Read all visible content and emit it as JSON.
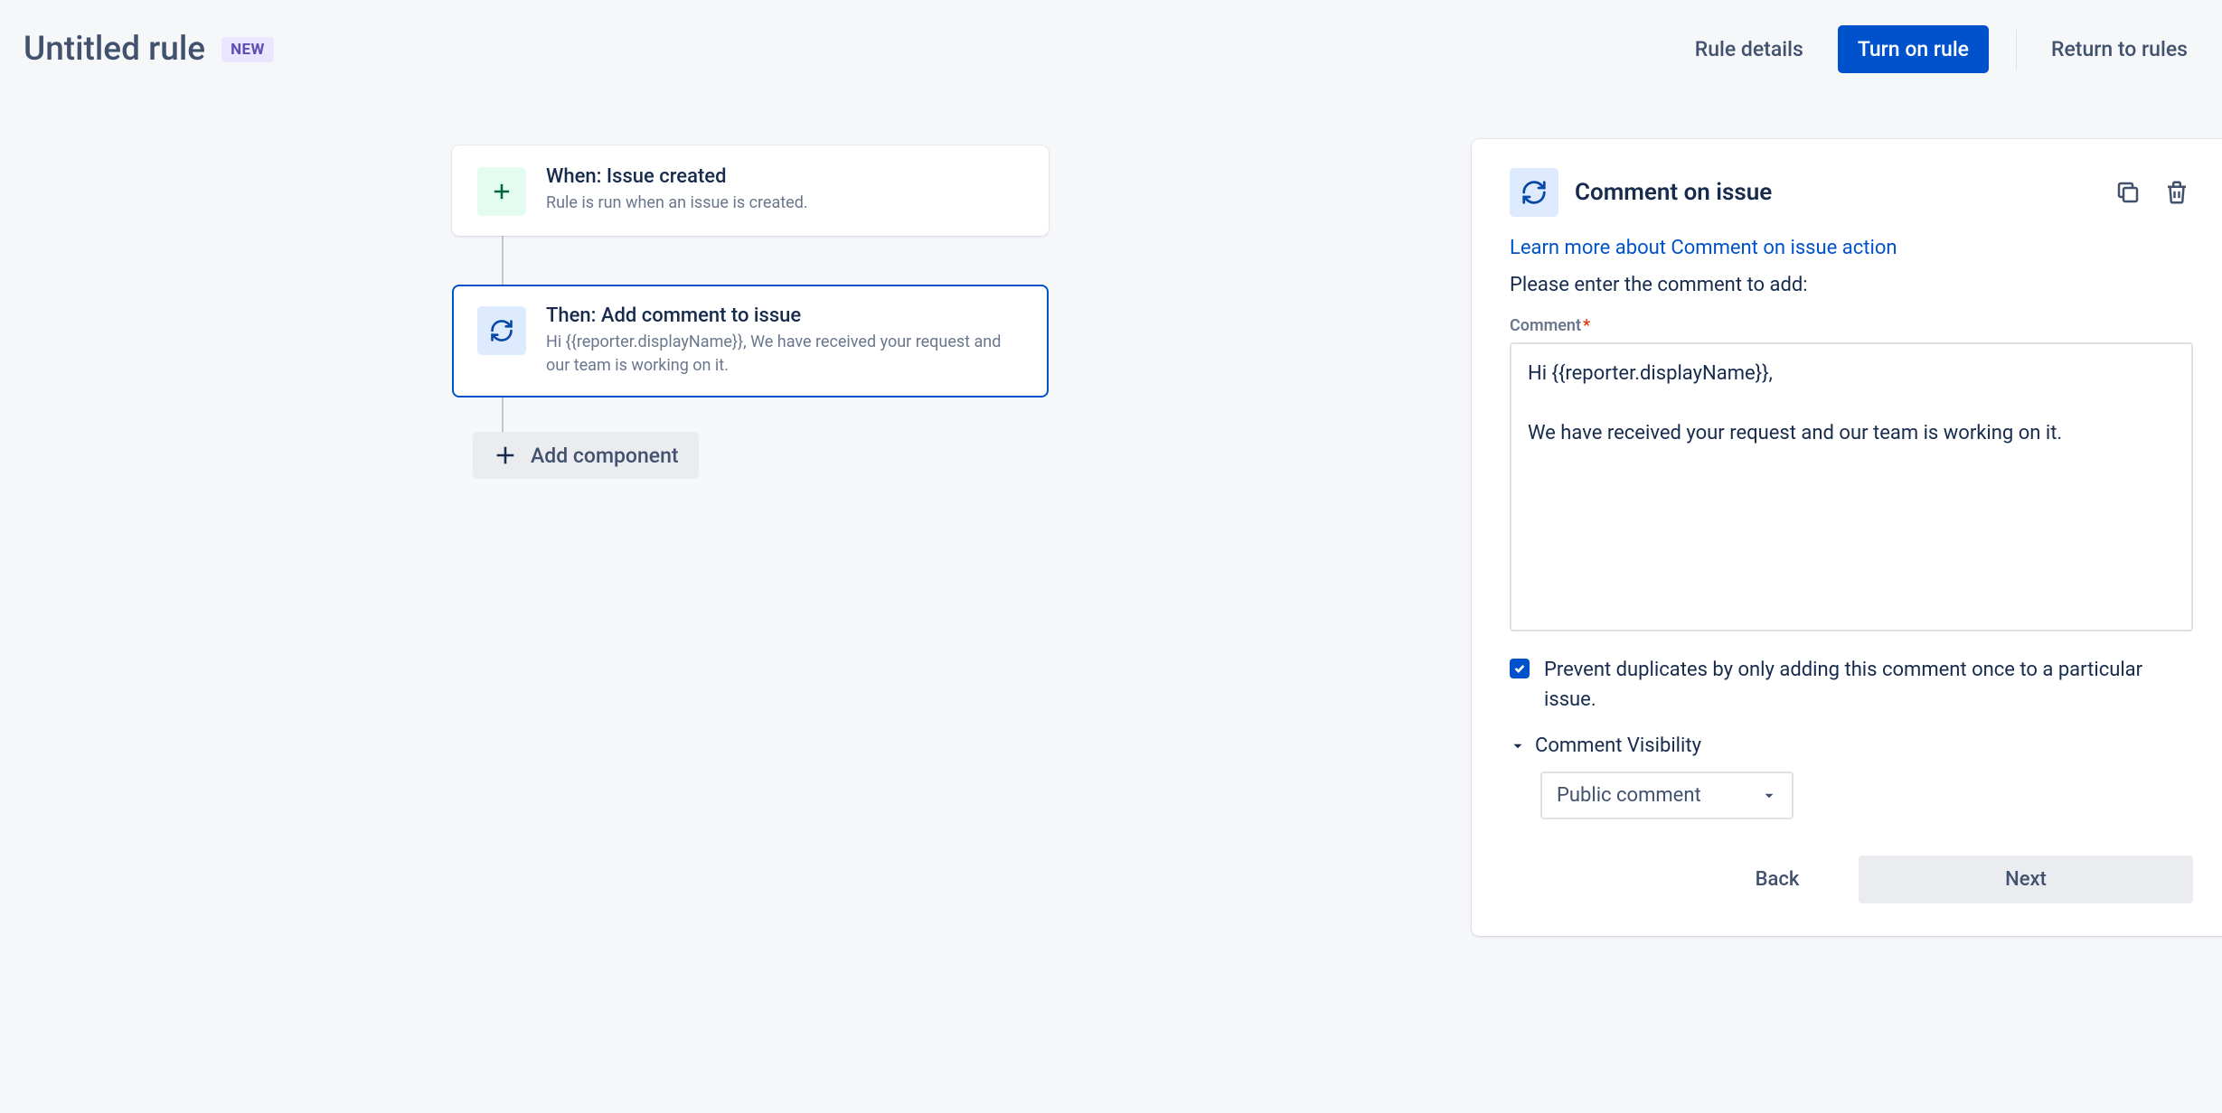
{
  "header": {
    "title": "Untitled rule",
    "badge": "NEW",
    "rule_details": "Rule details",
    "turn_on": "Turn on rule",
    "return": "Return to rules"
  },
  "flow": {
    "trigger": {
      "title": "When: Issue created",
      "subtitle": "Rule is run when an issue is created."
    },
    "action": {
      "title": "Then: Add comment to issue",
      "subtitle": "Hi {{reporter.displayName}}, We have received your request and our team is working on it."
    },
    "add_component": "Add component"
  },
  "panel": {
    "title": "Comment on issue",
    "learn_more": "Learn more about Comment on issue action",
    "instruction": "Please enter the comment to add:",
    "comment_label": "Comment",
    "comment_value": "Hi {{reporter.displayName}},\n\nWe have received your request and our team is working on it.",
    "prevent_dupes": "Prevent duplicates by only adding this comment once to a particular issue.",
    "visibility_label": "Comment Visibility",
    "visibility_value": "Public comment",
    "back": "Back",
    "next": "Next"
  }
}
